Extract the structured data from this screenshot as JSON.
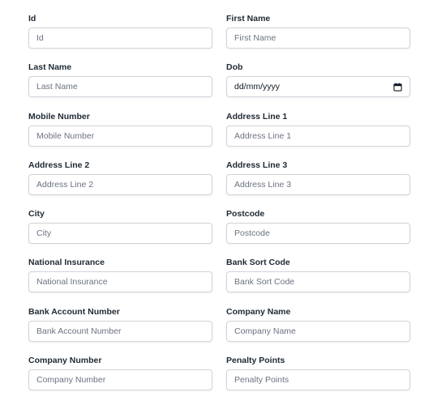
{
  "form": {
    "fields": [
      {
        "label": "Id",
        "placeholder": "Id"
      },
      {
        "label": "First Name",
        "placeholder": "First Name"
      },
      {
        "label": "Last Name",
        "placeholder": "Last Name"
      },
      {
        "label": "Dob",
        "placeholder": "dd/mm/yyyy",
        "type": "date"
      },
      {
        "label": "Mobile Number",
        "placeholder": "Mobile Number"
      },
      {
        "label": "Address Line 1",
        "placeholder": "Address Line 1"
      },
      {
        "label": "Address Line 2",
        "placeholder": "Address Line 2"
      },
      {
        "label": "Address Line 3",
        "placeholder": "Address Line 3"
      },
      {
        "label": "City",
        "placeholder": "City"
      },
      {
        "label": "Postcode",
        "placeholder": "Postcode"
      },
      {
        "label": "National Insurance",
        "placeholder": "National Insurance"
      },
      {
        "label": "Bank Sort Code",
        "placeholder": "Bank Sort Code"
      },
      {
        "label": "Bank Account Number",
        "placeholder": "Bank Account Number"
      },
      {
        "label": "Company Name",
        "placeholder": "Company Name"
      },
      {
        "label": "Company Number",
        "placeholder": "Company Number"
      },
      {
        "label": "Penalty Points",
        "placeholder": "Penalty Points"
      }
    ]
  },
  "icons": {
    "dob_picker": "calendar-icon"
  },
  "colors": {
    "input_border": "#cfd4da",
    "placeholder_text": "#6b7280",
    "label_text": "#1f2933"
  }
}
